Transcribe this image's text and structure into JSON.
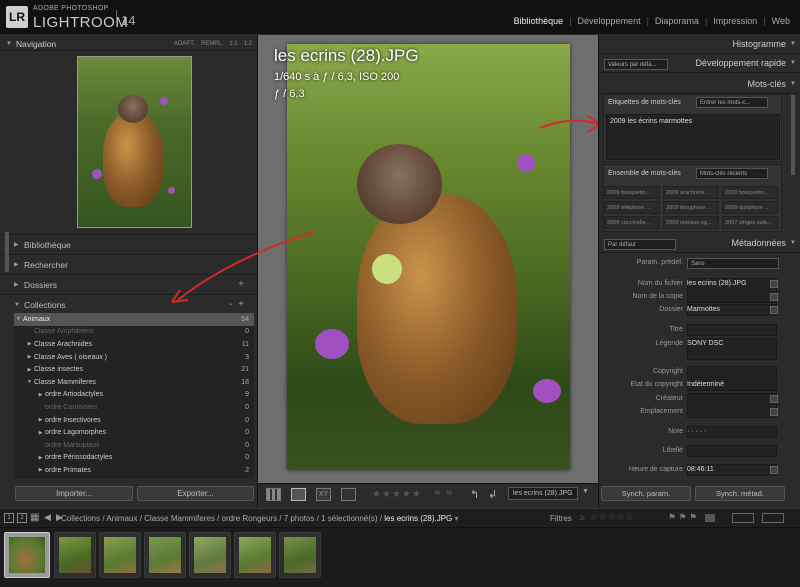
{
  "app": {
    "brand_small": "ADOBE PHOTOSHOP",
    "brand_big": "LIGHTROOM",
    "version": "14",
    "logo": "LR"
  },
  "modules": [
    "Bibliothèque",
    "Développement",
    "Diaporama",
    "Impression",
    "Web"
  ],
  "modules_active": "Bibliothèque",
  "left_panel": {
    "navigation": {
      "title": "Navigation",
      "options": [
        "ADAPT.",
        "REMPL.",
        "1:1",
        "1:2"
      ]
    },
    "sections": [
      "Bibliothèque",
      "Rechercher",
      "Dossiers",
      "Collections"
    ],
    "collections": [
      {
        "label": "Animaux",
        "count": "54",
        "level": 0,
        "state": "selected"
      },
      {
        "label": "Classe Amphibiens",
        "count": "0",
        "level": 1,
        "state": "dim"
      },
      {
        "label": "Classe Arachnides",
        "count": "11",
        "level": 1,
        "state": "normal"
      },
      {
        "label": "Classe Aves  ( oiseaux )",
        "count": "3",
        "level": 1,
        "state": "normal"
      },
      {
        "label": "Classe insectes",
        "count": "21",
        "level": 1,
        "state": "normal"
      },
      {
        "label": "Classe Mammiferes",
        "count": "18",
        "level": 1,
        "state": "open"
      },
      {
        "label": "ordre Artiodactyles",
        "count": "9",
        "level": 2,
        "state": "normal"
      },
      {
        "label": "ordre Carnivores",
        "count": "0",
        "level": 2,
        "state": "dim"
      },
      {
        "label": "ordre Insectivores",
        "count": "0",
        "level": 2,
        "state": "normal"
      },
      {
        "label": "ordre Lagomorphes",
        "count": "0",
        "level": 2,
        "state": "normal"
      },
      {
        "label": "ordre Marsupiaux",
        "count": "0",
        "level": 2,
        "state": "dim"
      },
      {
        "label": "ordre Périssodactyles",
        "count": "0",
        "level": 2,
        "state": "normal"
      },
      {
        "label": "ordre Primates",
        "count": "2",
        "level": 2,
        "state": "normal"
      }
    ],
    "import_label": "Importer...",
    "export_label": "Exporter..."
  },
  "photo": {
    "filename": "les ecrins (28).JPG",
    "exposure": "1/640 s à ƒ / 6,3, ISO 200",
    "aperture": "ƒ / 6,3"
  },
  "toolbar": {
    "select_value": "les ecrins (28).JPG"
  },
  "right_panel": {
    "histogram": "Histogramme",
    "quick_dev_preset": "Valeurs par défa...",
    "quick_dev": "Développement rapide",
    "keywords": "Mots-clés",
    "kw_tags_label": "Etiquettes de mots-clés",
    "kw_tags_select": "Entrer les mots-c...",
    "kw_tags_value": "2009 les écrins marmottes",
    "kw_set_label": "Ensemble de mots-clés",
    "kw_set_select": "Mots-clés récents",
    "kw_set_items": [
      "2009 bouquetin...",
      "2009 arachnide ...",
      "2010 bouquetin...",
      "2009 téléphore ...",
      "2009 doryphore ...",
      "2009 doriphore ...",
      "2009 coccinelle...",
      "2009 oiseaux eg...",
      "2007 singes sula..."
    ],
    "metadata_preset": "Par défaut",
    "metadata": "Métadonnées",
    "param_label": "Param. prédéf.",
    "param_value": "Sans",
    "fields": [
      {
        "label": "Nom du fichier",
        "value": "les ecrins (28).JPG"
      },
      {
        "label": "Nom de la copie",
        "value": ""
      },
      {
        "label": "Dossier",
        "value": "Marmottes"
      },
      {
        "label": "Titre",
        "value": ""
      },
      {
        "label": "Légende",
        "value": "SONY DSC"
      },
      {
        "label": "Copyright",
        "value": ""
      },
      {
        "label": "Etat du copyright",
        "value": "Indéterminé"
      },
      {
        "label": "Créateur",
        "value": ""
      },
      {
        "label": "Emplacement",
        "value": ""
      },
      {
        "label": "Note",
        "value": "·  ·  ·  ·  ·"
      },
      {
        "label": "Libellé",
        "value": ""
      },
      {
        "label": "Heure de capture",
        "value": "08:46:11"
      }
    ],
    "sync_params": "Synch. param.",
    "sync_meta": "Synch. métad."
  },
  "filmbar": {
    "monitor1": "1",
    "monitor2": "2",
    "path": "Collections / Animaux / Classe Mammiferes / ordre Rongeurs / 7 photos / 1 sélectionné(s) / ",
    "current": "les ecrins (28).JPG",
    "filters": "Filtres"
  },
  "colors": {
    "accent_arrow": "#d42a2a",
    "panel_bg": "#2b2b2b",
    "center_bg": "#6e6e6e"
  }
}
